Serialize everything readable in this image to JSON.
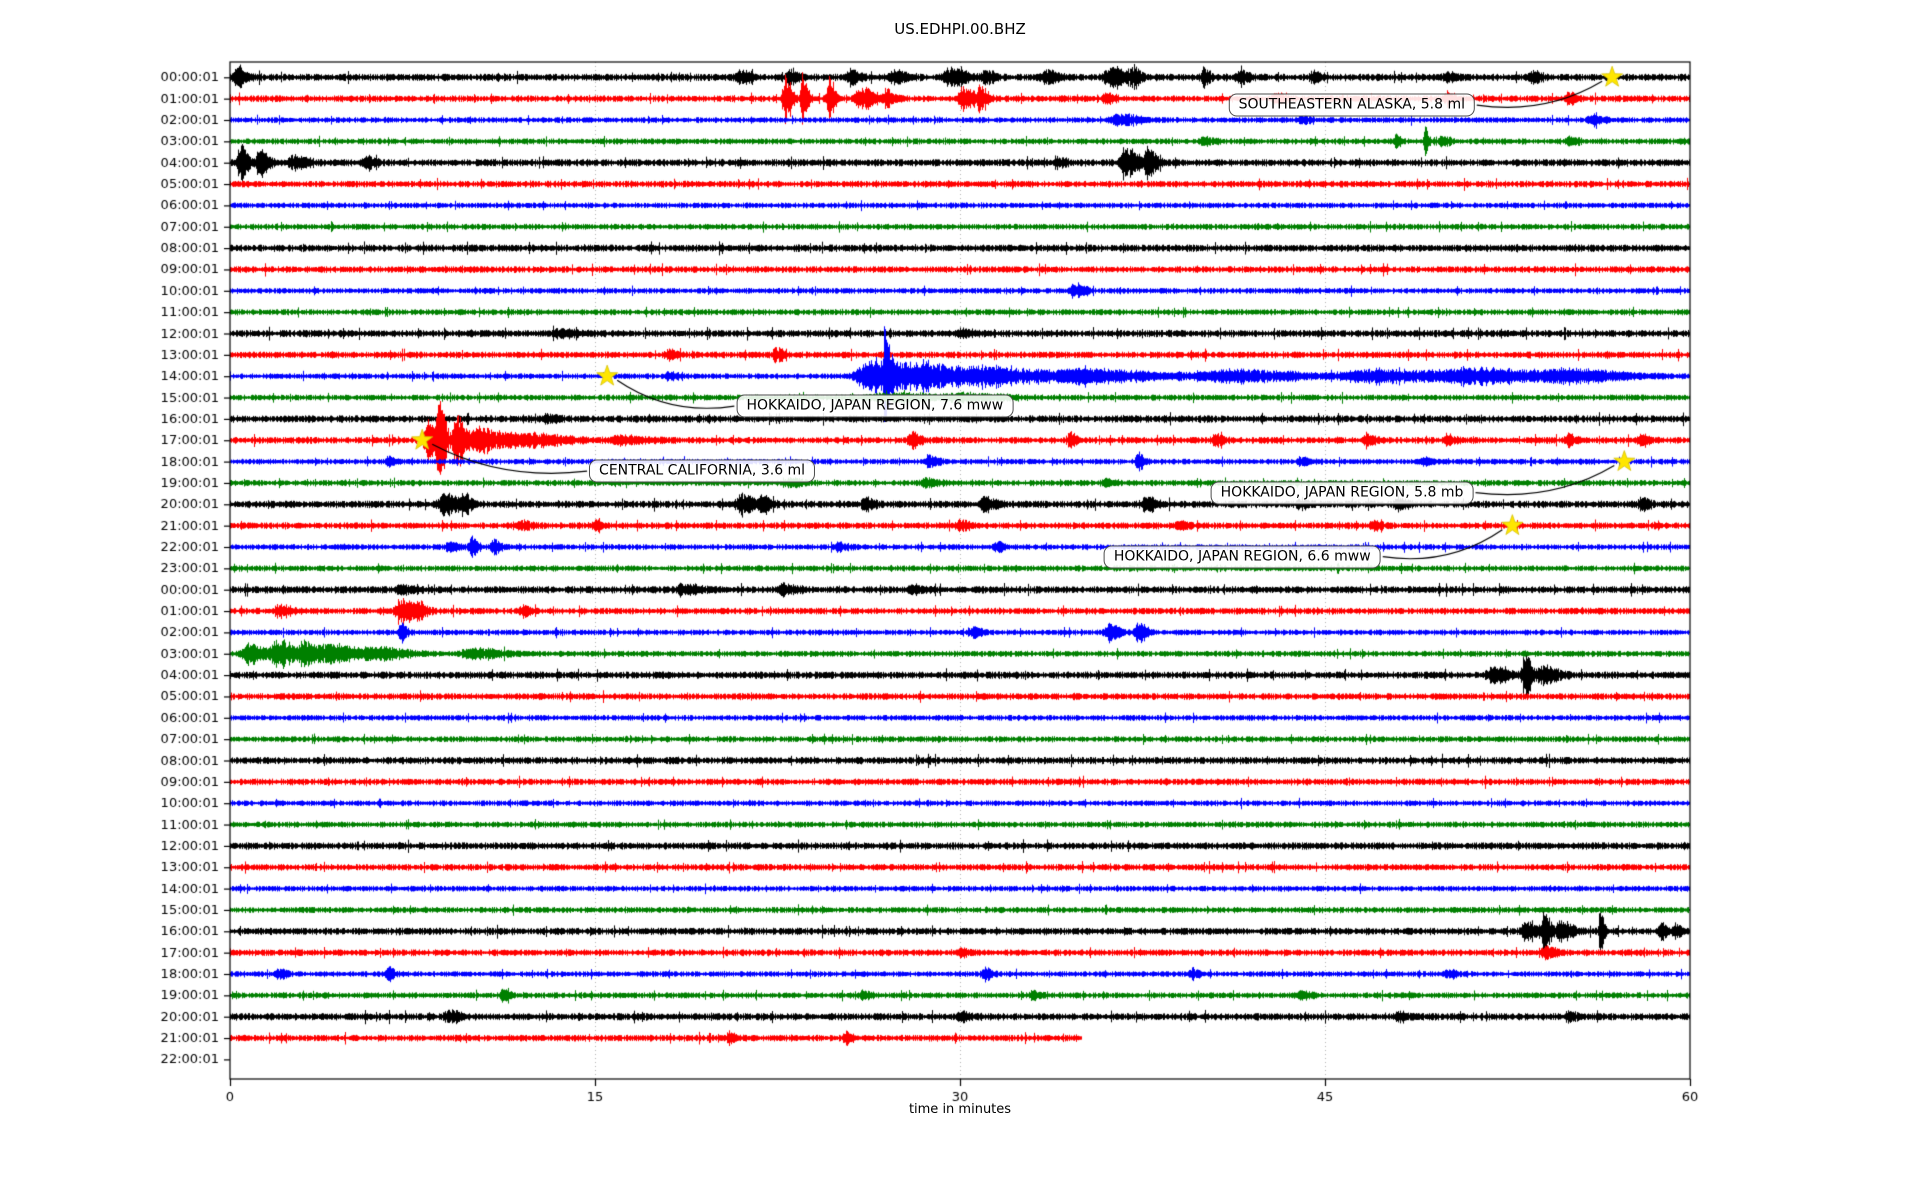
{
  "chart_data": {
    "type": "line",
    "subtype": "seismogram-dayplot",
    "title": "US.EDHPI.00.BHZ",
    "xlabel": "time in minutes",
    "x_range": [
      0,
      60
    ],
    "x_ticks": [
      0,
      15,
      30,
      45,
      60
    ],
    "grid_minutes": [
      15,
      30,
      45
    ],
    "grid_on": true,
    "colors": {
      "trace_cycle": [
        "#000000",
        "#ff0000",
        "#0000ff",
        "#008000"
      ],
      "grid": "#b0b0b0",
      "axis": "#000000",
      "star": "#ffe600",
      "annotation_border": "#4d4d4d"
    },
    "rows": [
      {
        "label": "00:00:01",
        "events": [
          [
            0.3,
            8,
            0.25
          ],
          [
            21,
            4,
            0.4
          ],
          [
            23,
            4,
            0.3
          ],
          [
            25.5,
            5,
            0.3
          ],
          [
            27.3,
            4,
            0.4
          ],
          [
            29.6,
            6,
            0.5
          ],
          [
            31,
            5,
            0.3
          ],
          [
            33.5,
            4,
            0.4
          ],
          [
            36.2,
            7,
            0.5
          ],
          [
            37.1,
            6,
            0.3
          ],
          [
            40,
            6,
            0.2
          ],
          [
            41.5,
            4,
            0.3
          ],
          [
            44.5,
            3,
            0.3
          ],
          [
            50,
            3,
            0.3
          ],
          [
            53.5,
            4,
            0.3
          ]
        ]
      },
      {
        "label": "01:00:01",
        "events": [
          [
            22.8,
            16,
            0.22
          ],
          [
            23.5,
            19,
            0.18
          ],
          [
            24.6,
            17,
            0.18
          ],
          [
            25.9,
            7,
            0.5
          ],
          [
            27,
            5,
            0.3
          ],
          [
            30.1,
            8,
            0.35
          ],
          [
            30.8,
            9,
            0.25
          ],
          [
            36,
            3,
            0.3
          ],
          [
            43,
            3,
            0.3
          ],
          [
            50,
            3,
            0.3
          ],
          [
            55,
            3.5,
            0.25
          ]
        ]
      },
      {
        "label": "02:00:01",
        "events": [
          [
            36.5,
            3.5,
            0.7
          ],
          [
            44,
            2.5,
            0.3
          ],
          [
            56,
            3,
            0.4
          ]
        ]
      },
      {
        "label": "03:00:01",
        "events": [
          [
            40,
            2.5,
            0.3
          ],
          [
            47.9,
            8,
            0.12
          ],
          [
            49.1,
            11,
            0.12
          ],
          [
            49.8,
            4,
            0.25
          ],
          [
            55,
            2.5,
            0.3
          ]
        ]
      },
      {
        "label": "04:00:01",
        "events": [
          [
            0.4,
            13,
            0.22
          ],
          [
            1.2,
            9,
            0.3
          ],
          [
            2.6,
            5,
            0.45
          ],
          [
            5.6,
            4,
            0.3
          ],
          [
            34,
            3,
            0.3
          ],
          [
            36.8,
            11,
            0.45
          ],
          [
            37.7,
            9,
            0.3
          ]
        ]
      },
      {
        "label": "05:00:01",
        "events": []
      },
      {
        "label": "06:00:01",
        "events": []
      },
      {
        "label": "07:00:01",
        "events": []
      },
      {
        "label": "08:00:01",
        "events": []
      },
      {
        "label": "09:00:01",
        "events": []
      },
      {
        "label": "10:00:01",
        "events": [
          [
            34.7,
            4.5,
            0.35
          ]
        ]
      },
      {
        "label": "11:00:01",
        "events": []
      },
      {
        "label": "12:00:01",
        "events": [
          [
            13.5,
            2.5,
            0.6
          ],
          [
            30,
            2,
            0.5
          ]
        ]
      },
      {
        "label": "13:00:01",
        "events": [
          [
            18,
            2.5,
            0.3
          ],
          [
            22.4,
            4.5,
            0.22
          ]
        ]
      },
      {
        "label": "14:00:01",
        "events": [
          [
            18,
            2.5,
            0.3
          ],
          [
            26.4,
            13,
            1.2
          ],
          [
            26.9,
            23,
            0.15
          ],
          [
            28.5,
            8,
            1.2
          ],
          [
            31,
            6,
            2
          ],
          [
            35,
            4,
            2.5
          ],
          [
            41,
            3.5,
            2.5
          ],
          [
            47,
            4,
            2.5
          ],
          [
            51,
            4.5,
            2.5
          ],
          [
            55,
            3.5,
            2
          ]
        ]
      },
      {
        "label": "15:00:01",
        "events": [
          [
            27,
            2.5,
            1.5
          ],
          [
            30,
            2,
            1.5
          ]
        ]
      },
      {
        "label": "16:00:01",
        "events": [
          [
            13,
            2.5,
            0.4
          ]
        ]
      },
      {
        "label": "17:00:01",
        "events": [
          [
            8.15,
            14,
            0.4
          ],
          [
            8.6,
            21,
            0.22
          ],
          [
            9.3,
            18,
            0.28
          ],
          [
            10.2,
            9,
            0.7
          ],
          [
            12,
            4,
            1.4
          ],
          [
            16,
            3,
            0.8
          ],
          [
            28,
            5,
            0.3
          ],
          [
            34.5,
            6,
            0.22
          ],
          [
            40.5,
            3.5,
            0.3
          ],
          [
            46.7,
            4,
            0.3
          ],
          [
            50,
            3,
            0.3
          ],
          [
            55,
            3.5,
            0.3
          ],
          [
            58,
            3,
            0.3
          ]
        ]
      },
      {
        "label": "18:00:01",
        "events": [
          [
            6.5,
            3.5,
            0.2
          ],
          [
            28.7,
            4.5,
            0.3
          ],
          [
            37.3,
            5.5,
            0.22
          ],
          [
            44,
            3,
            0.3
          ],
          [
            49,
            2.5,
            0.3
          ]
        ]
      },
      {
        "label": "19:00:01",
        "events": [
          [
            23,
            3.5,
            0.35
          ],
          [
            28.6,
            3,
            0.4
          ],
          [
            36,
            2.5,
            0.3
          ]
        ]
      },
      {
        "label": "20:00:01",
        "events": [
          [
            8.8,
            7,
            0.45
          ],
          [
            9.6,
            6,
            0.3
          ],
          [
            21,
            6,
            0.45
          ],
          [
            21.9,
            5,
            0.3
          ],
          [
            26.1,
            4,
            0.3
          ],
          [
            31,
            4.5,
            0.35
          ],
          [
            37.6,
            5,
            0.35
          ],
          [
            44,
            3,
            0.3
          ],
          [
            48,
            3.5,
            0.3
          ],
          [
            58,
            4.5,
            0.25
          ]
        ]
      },
      {
        "label": "21:00:01",
        "events": [
          [
            12,
            3,
            0.3
          ],
          [
            15,
            3.5,
            0.25
          ],
          [
            30,
            3.5,
            0.3
          ],
          [
            39,
            2.5,
            0.3
          ],
          [
            47,
            2.5,
            0.3
          ]
        ]
      },
      {
        "label": "22:00:01",
        "events": [
          [
            9,
            3.5,
            0.3
          ],
          [
            9.9,
            7,
            0.2
          ],
          [
            10.8,
            5,
            0.25
          ],
          [
            25,
            2.5,
            0.3
          ],
          [
            31.5,
            3,
            0.3
          ]
        ]
      },
      {
        "label": "23:00:01",
        "events": []
      },
      {
        "label": "00:00:01",
        "events": [
          [
            7,
            3,
            0.4
          ],
          [
            18.6,
            3.5,
            0.5
          ],
          [
            22.7,
            3.5,
            0.4
          ],
          [
            28,
            2.5,
            0.4
          ]
        ]
      },
      {
        "label": "01:00:01",
        "events": [
          [
            2,
            3.5,
            0.4
          ],
          [
            7,
            7.5,
            0.45
          ],
          [
            7.7,
            5.5,
            0.3
          ],
          [
            12,
            3,
            0.3
          ]
        ]
      },
      {
        "label": "02:00:01",
        "events": [
          [
            7,
            6.5,
            0.18
          ],
          [
            30.5,
            3.5,
            0.3
          ],
          [
            36.1,
            5.5,
            0.35
          ],
          [
            37.3,
            6.5,
            0.28
          ]
        ]
      },
      {
        "label": "03:00:01",
        "events": [
          [
            0.8,
            7,
            0.6
          ],
          [
            2,
            9.5,
            0.5
          ],
          [
            3.1,
            8,
            0.6
          ],
          [
            4.3,
            5.5,
            0.8
          ],
          [
            6,
            4,
            1
          ],
          [
            10,
            3,
            1
          ]
        ]
      },
      {
        "label": "04:00:01",
        "events": [
          [
            51.9,
            5,
            0.5
          ],
          [
            53.2,
            13,
            0.25
          ],
          [
            54,
            5.5,
            0.5
          ]
        ]
      },
      {
        "label": "05:00:01",
        "events": []
      },
      {
        "label": "06:00:01",
        "events": []
      },
      {
        "label": "07:00:01",
        "events": []
      },
      {
        "label": "08:00:01",
        "events": []
      },
      {
        "label": "09:00:01",
        "events": []
      },
      {
        "label": "10:00:01",
        "events": []
      },
      {
        "label": "11:00:01",
        "events": []
      },
      {
        "label": "12:00:01",
        "events": []
      },
      {
        "label": "13:00:01",
        "events": []
      },
      {
        "label": "14:00:01",
        "events": []
      },
      {
        "label": "15:00:01",
        "events": []
      },
      {
        "label": "16:00:01",
        "events": [
          [
            53.3,
            7,
            0.4
          ],
          [
            54,
            11,
            0.25
          ],
          [
            54.7,
            6,
            0.4
          ],
          [
            56.3,
            15,
            0.13
          ],
          [
            58.8,
            5.5,
            0.22
          ],
          [
            59.4,
            4.5,
            0.2
          ]
        ]
      },
      {
        "label": "17:00:01",
        "events": [
          [
            30,
            2.5,
            0.3
          ],
          [
            54,
            3.5,
            0.4
          ]
        ]
      },
      {
        "label": "18:00:01",
        "events": [
          [
            2,
            3.5,
            0.25
          ],
          [
            6.5,
            4.5,
            0.2
          ],
          [
            31,
            3.5,
            0.25
          ],
          [
            39.5,
            3.5,
            0.25
          ],
          [
            50,
            2.5,
            0.3
          ]
        ]
      },
      {
        "label": "19:00:01",
        "events": [
          [
            11.2,
            4.5,
            0.2
          ],
          [
            26,
            2.5,
            0.3
          ],
          [
            33,
            2.5,
            0.3
          ],
          [
            44,
            2.5,
            0.3
          ]
        ]
      },
      {
        "label": "20:00:01",
        "events": [
          [
            9,
            3.5,
            0.4
          ],
          [
            30,
            2.5,
            0.4
          ],
          [
            48,
            2.5,
            0.3
          ],
          [
            55,
            2.5,
            0.3
          ]
        ]
      },
      {
        "label": "21:00:01",
        "end_minute": 35,
        "events": [
          [
            20.5,
            4.5,
            0.22
          ],
          [
            25.3,
            3.5,
            0.25
          ]
        ]
      },
      {
        "label": "22:00:01",
        "empty": true,
        "events": []
      }
    ],
    "annotations": [
      {
        "text": "SOUTHEASTERN ALASKA, 5.8 ml",
        "star_minute": 56.8,
        "star_row": 0,
        "label_minute": 46.1,
        "label_row": 1.3,
        "side": "right"
      },
      {
        "text": "HOKKAIDO, JAPAN REGION, 7.6 mww",
        "star_minute": 15.5,
        "star_row": 14,
        "label_minute": 26.5,
        "label_row": 15.4,
        "side": "left"
      },
      {
        "text": "CENTRAL CALIFORNIA, 3.6 ml",
        "star_minute": 7.9,
        "star_row": 17,
        "label_minute": 19.4,
        "label_row": 18.45,
        "side": "left"
      },
      {
        "text": "HOKKAIDO, JAPAN REGION, 5.8 mb",
        "star_minute": 57.3,
        "star_row": 18,
        "label_minute": 45.7,
        "label_row": 19.45,
        "side": "right"
      },
      {
        "text": "HOKKAIDO, JAPAN REGION, 6.6 mww",
        "star_minute": 52.7,
        "star_row": 21,
        "label_minute": 41.6,
        "label_row": 22.45,
        "side": "right"
      }
    ]
  }
}
